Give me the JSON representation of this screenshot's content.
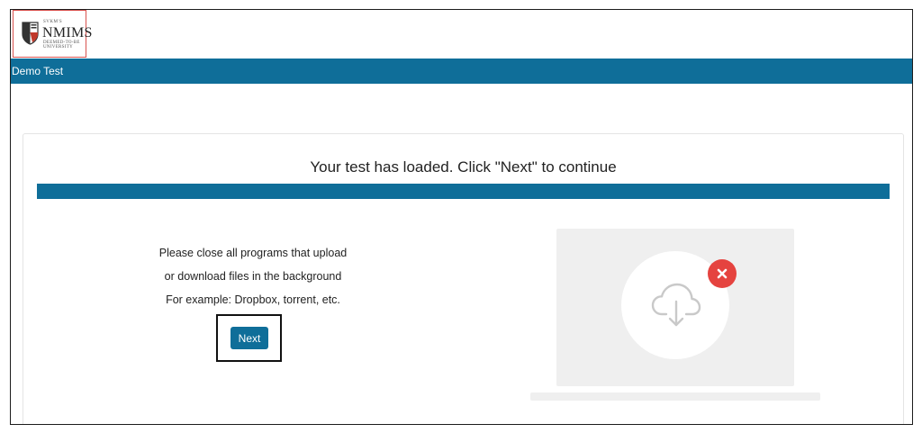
{
  "logo": {
    "small_text": "SVKM'S",
    "name": "NMIMS",
    "subtitle": "DEEMED-TO-BE UNIVERSITY"
  },
  "header": {
    "title": "Demo Test"
  },
  "main": {
    "heading": "Your test has loaded. Click \"Next\" to continue",
    "instructions": [
      "Please close all programs that upload",
      "or download files in the background",
      "For example: Dropbox, torrent, etc."
    ],
    "next_label": "Next"
  },
  "illustration": {
    "icon": "cloud-download-icon",
    "badge_icon": "close-icon"
  },
  "colors": {
    "brand_blue": "#0f6e99",
    "error_red": "#e5433f",
    "card_gray": "#efefef"
  }
}
